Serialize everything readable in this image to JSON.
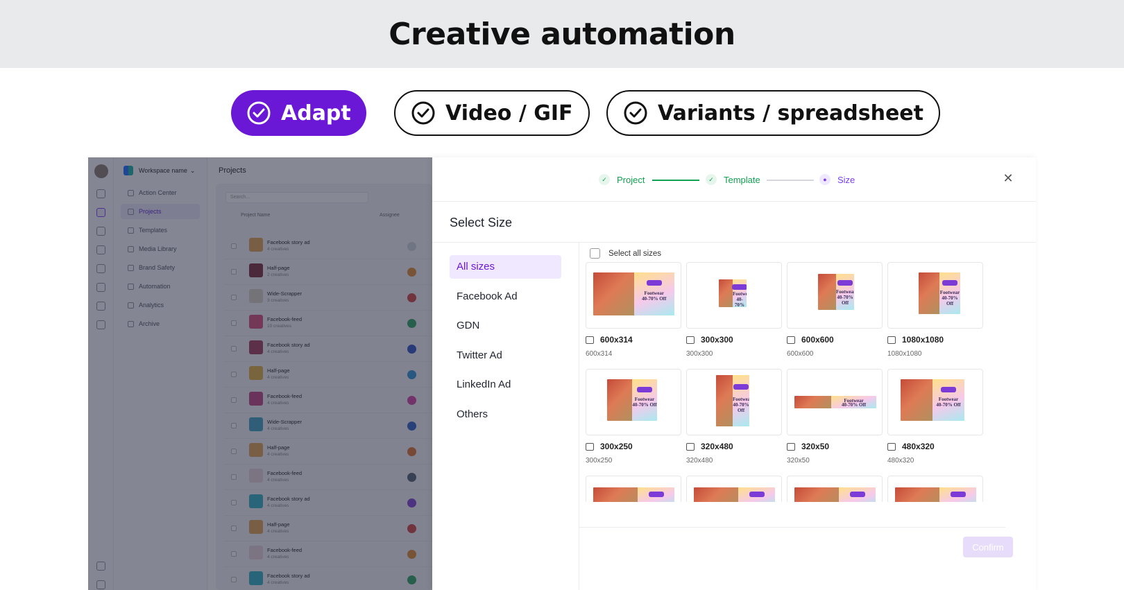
{
  "hero": {
    "title": "Creative automation",
    "pills": [
      {
        "label": "Adapt",
        "active": true
      },
      {
        "label": "Video / GIF",
        "active": false
      },
      {
        "label": "Variants / spreadsheet",
        "active": false
      }
    ]
  },
  "app": {
    "workspace": "Workspace name",
    "page_title": "Projects",
    "nav": [
      "Action Center",
      "Projects",
      "Templates",
      "Media Library",
      "Brand Safety",
      "Automation",
      "Analytics",
      "Archive"
    ],
    "search_placeholder": "Search...",
    "columns": {
      "name": "Project Name",
      "assignee": "Assignee"
    },
    "rows": [
      {
        "name": "Facebook story ad",
        "sub": "4 creatives"
      },
      {
        "name": "Half-page",
        "sub": "2 creatives"
      },
      {
        "name": "Wide-Scrapper",
        "sub": "3 creatives"
      },
      {
        "name": "Facebook-feed",
        "sub": "10 creatives"
      },
      {
        "name": "Facebook story ad",
        "sub": "4 creatives"
      },
      {
        "name": "Half-page",
        "sub": "4 creatives"
      },
      {
        "name": "Facebook-feed",
        "sub": "4 creatives"
      },
      {
        "name": "Wide-Scrapper",
        "sub": "4 creatives"
      },
      {
        "name": "Half-page",
        "sub": "4 creatives"
      },
      {
        "name": "Facebook-feed",
        "sub": "4 creatives"
      },
      {
        "name": "Facebook story ad",
        "sub": "4 creatives"
      },
      {
        "name": "Half-page",
        "sub": "4 creatives"
      },
      {
        "name": "Facebook-feed",
        "sub": "4 creatives"
      },
      {
        "name": "Facebook story ad",
        "sub": "4 creatives"
      }
    ]
  },
  "modal": {
    "steps": [
      {
        "label": "Project",
        "state": "done"
      },
      {
        "label": "Template",
        "state": "done"
      },
      {
        "label": "Size",
        "state": "current"
      }
    ],
    "title": "Select Size",
    "categories": [
      "All sizes",
      "Facebook Ad",
      "GDN",
      "Twitter Ad",
      "LinkedIn Ad",
      "Others"
    ],
    "select_all": "Select all sizes",
    "ad_texts": {
      "line1": "Footwear",
      "line2": "40-70% Off"
    },
    "sizes": [
      {
        "name": "600x314",
        "sub": "600x314"
      },
      {
        "name": "300x300",
        "sub": "300x300"
      },
      {
        "name": "600x600",
        "sub": "600x600"
      },
      {
        "name": "1080x1080",
        "sub": "1080x1080"
      },
      {
        "name": "300x250",
        "sub": "300x250"
      },
      {
        "name": "320x480",
        "sub": "320x480"
      },
      {
        "name": "320x50",
        "sub": "320x50"
      },
      {
        "name": "480x320",
        "sub": "480x320"
      }
    ],
    "confirm": "Confirm"
  },
  "colors": {
    "accent": "#6a18d6",
    "success": "#12a150",
    "confirm_disabled": "#e7ddfb"
  }
}
